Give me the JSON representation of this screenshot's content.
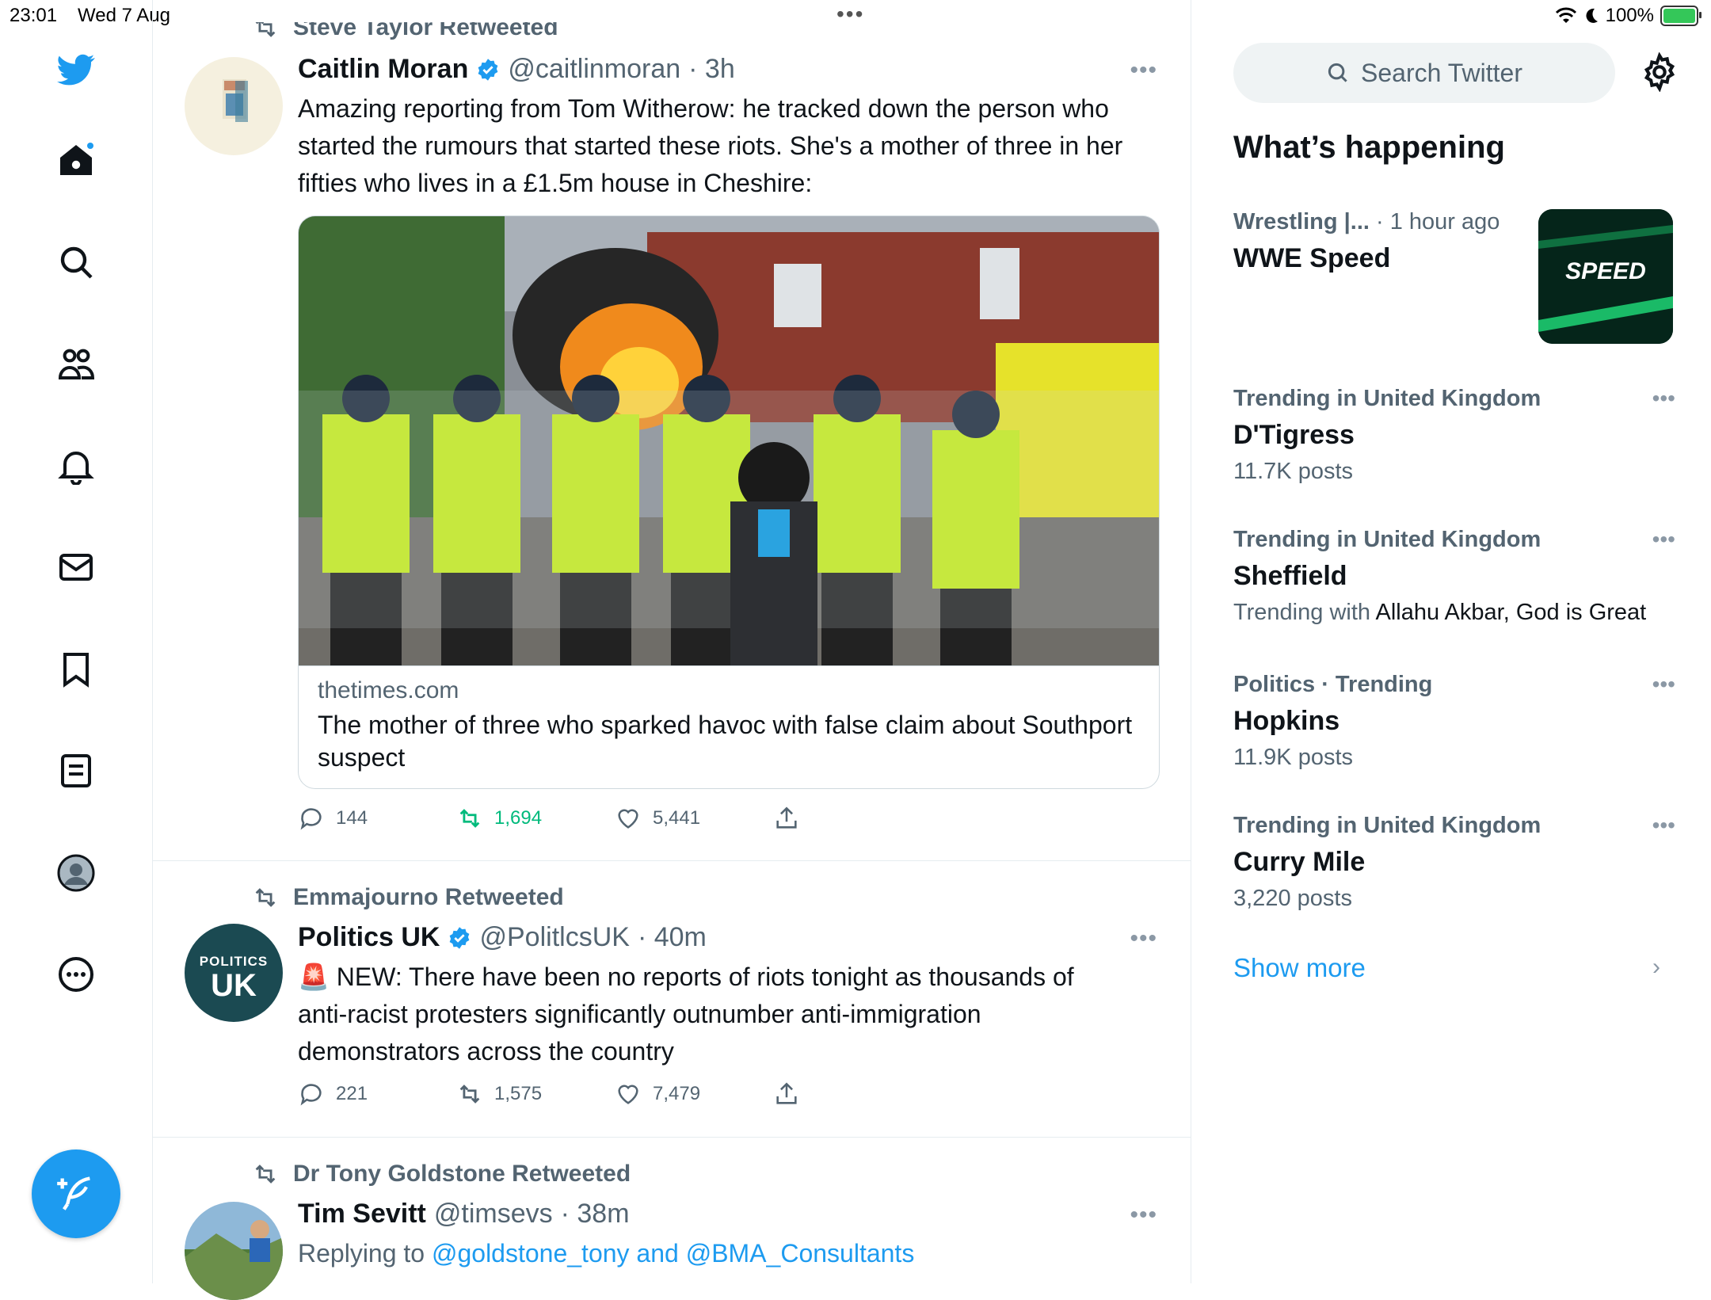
{
  "status_bar": {
    "time": "23:01",
    "date": "Wed 7 Aug",
    "battery": "100%"
  },
  "nav": {
    "icons": [
      "twitter-logo",
      "home-icon",
      "search-icon",
      "communities-icon",
      "notifications-icon",
      "messages-icon",
      "bookmarks-icon",
      "lists-icon",
      "profile-icon",
      "more-icon",
      "compose-icon"
    ]
  },
  "tweets": [
    {
      "retweeted_by": "Steve Taylor Retweeted",
      "name": "Caitlin Moran",
      "handle": "@caitlinmoran",
      "time": "· 3h",
      "text": "Amazing reporting from Tom Witherow: he tracked down the person who started the rumours that started these riots. She's a mother of three in her fifties who lives in a £1.5m house in Cheshire:",
      "card": {
        "domain": "thetimes.com",
        "title": "The mother of three who sparked havoc with false claim about Southport suspect"
      },
      "replies": "144",
      "retweets": "1,694",
      "likes": "5,441"
    },
    {
      "retweeted_by": "Emmajourno Retweeted",
      "name": "Politics UK",
      "handle": "@PolitlcsUK",
      "time": "· 40m",
      "text_emoji": "🚨",
      "text": "NEW: There have been no reports of riots tonight as thousands of anti-racist protesters significantly outnumber anti-immigration demonstrators across the country",
      "avatar_top": "POLITICS",
      "avatar_bottom": "UK",
      "replies": "221",
      "retweets": "1,575",
      "likes": "7,479"
    },
    {
      "retweeted_by": "Dr Tony Goldstone Retweeted",
      "name": "Tim Sevitt",
      "handle": "@timsevs",
      "time": "· 38m",
      "reply_prefix": "Replying to",
      "reply_to": "@goldstone_tony and @BMA_Consultants"
    }
  ],
  "sidebar": {
    "search_placeholder": "Search Twitter",
    "heading": "What’s happening",
    "featured": {
      "context": "Wrestling |...",
      "time": "· 1 hour ago",
      "title": "WWE Speed",
      "image_text": "SPEED"
    },
    "trends": [
      {
        "context": "Trending in United Kingdom",
        "title": "D'Tigress",
        "sub": "11.7K posts"
      },
      {
        "context": "Trending in United Kingdom",
        "title": "Sheffield",
        "sub_prefix": "Trending with",
        "sub_dark": "Allahu Akbar, God is Great"
      },
      {
        "context": "Politics · Trending",
        "title": "Hopkins",
        "sub": "11.9K posts"
      },
      {
        "context": "Trending in United Kingdom",
        "title": "Curry Mile",
        "sub": "3,220 posts"
      }
    ],
    "show_more": "Show more"
  },
  "colors": {
    "accent": "#1d9bf0",
    "retweet_active": "#00ba7c",
    "muted": "#536471"
  }
}
